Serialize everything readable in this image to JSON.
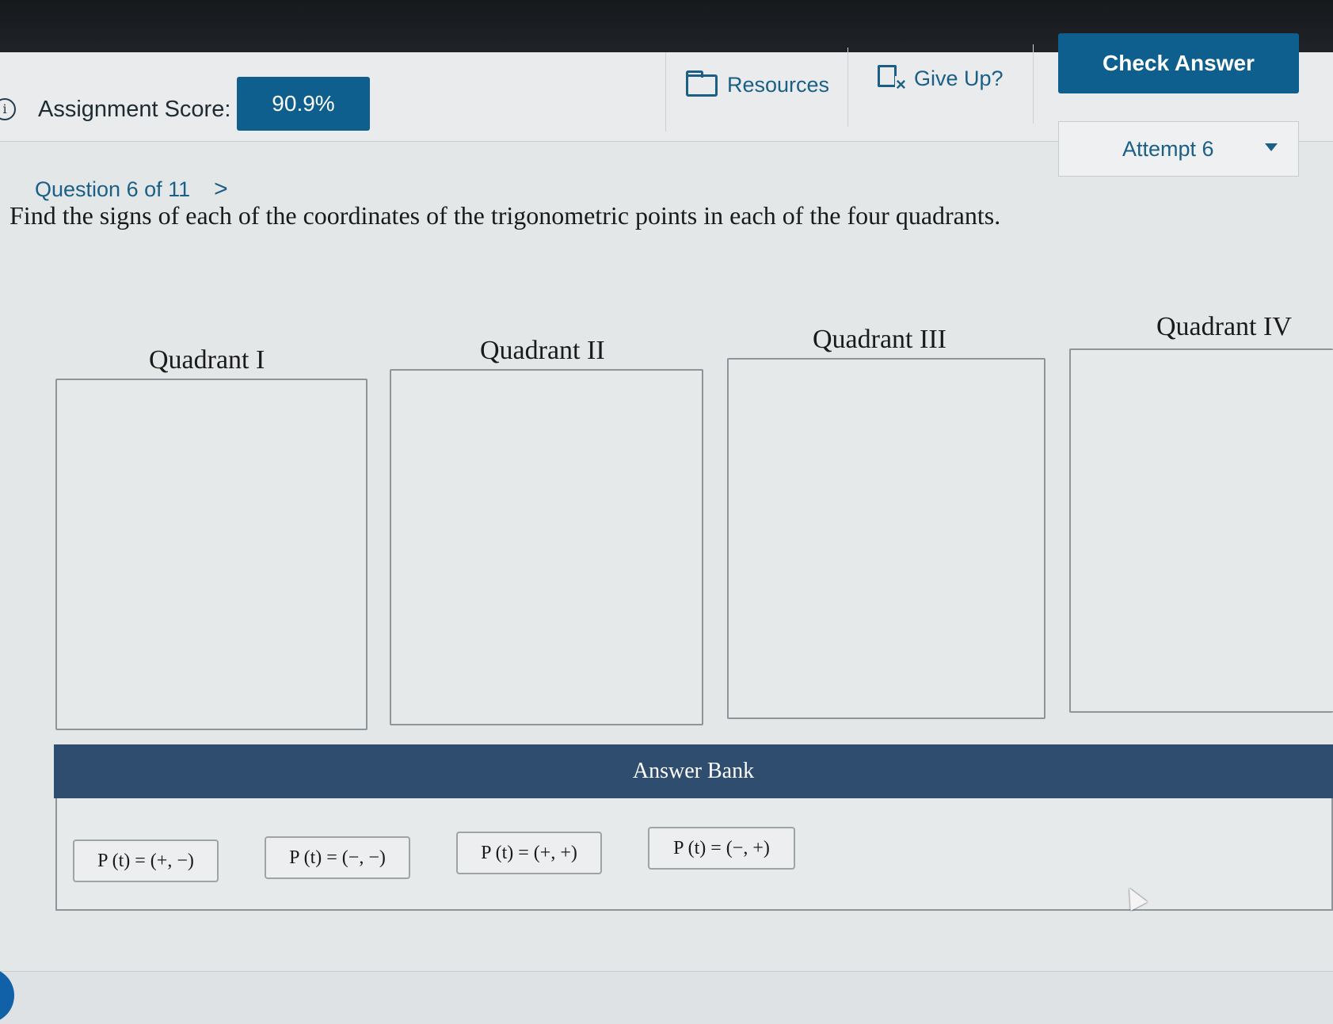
{
  "toolbar": {
    "score_label": "Assignment Score:",
    "score_value": "90.9%",
    "resources_label": "Resources",
    "give_up_label": "Give Up?",
    "check_answer_label": "Check Answer",
    "attempt_label": "Attempt 6"
  },
  "question": {
    "nav_label": "Question 6 of 11",
    "next_glyph": ">",
    "prompt": "Find the signs of each of the coordinates of the trigonometric points in each of the four quadrants."
  },
  "quadrants": [
    {
      "label": "Quadrant I"
    },
    {
      "label": "Quadrant II"
    },
    {
      "label": "Quadrant III"
    },
    {
      "label": "Quadrant IV"
    }
  ],
  "answer_bank": {
    "title": "Answer Bank",
    "items": [
      "P (t) = (+, −)",
      "P (t) = (−, −)",
      "P (t) = (+, +)",
      "P (t) = (−, +)"
    ]
  },
  "icons": {
    "info": "info-icon",
    "resources": "folder-icon",
    "give_up": "give-up-icon",
    "attempt_dropdown": "caret-down-icon",
    "next": "chevron-right-icon"
  },
  "colors": {
    "primary": "#0e5f8e",
    "link": "#1b5f86",
    "bank_header": "#2f4d6e",
    "page_bg": "#e4e7e8"
  }
}
